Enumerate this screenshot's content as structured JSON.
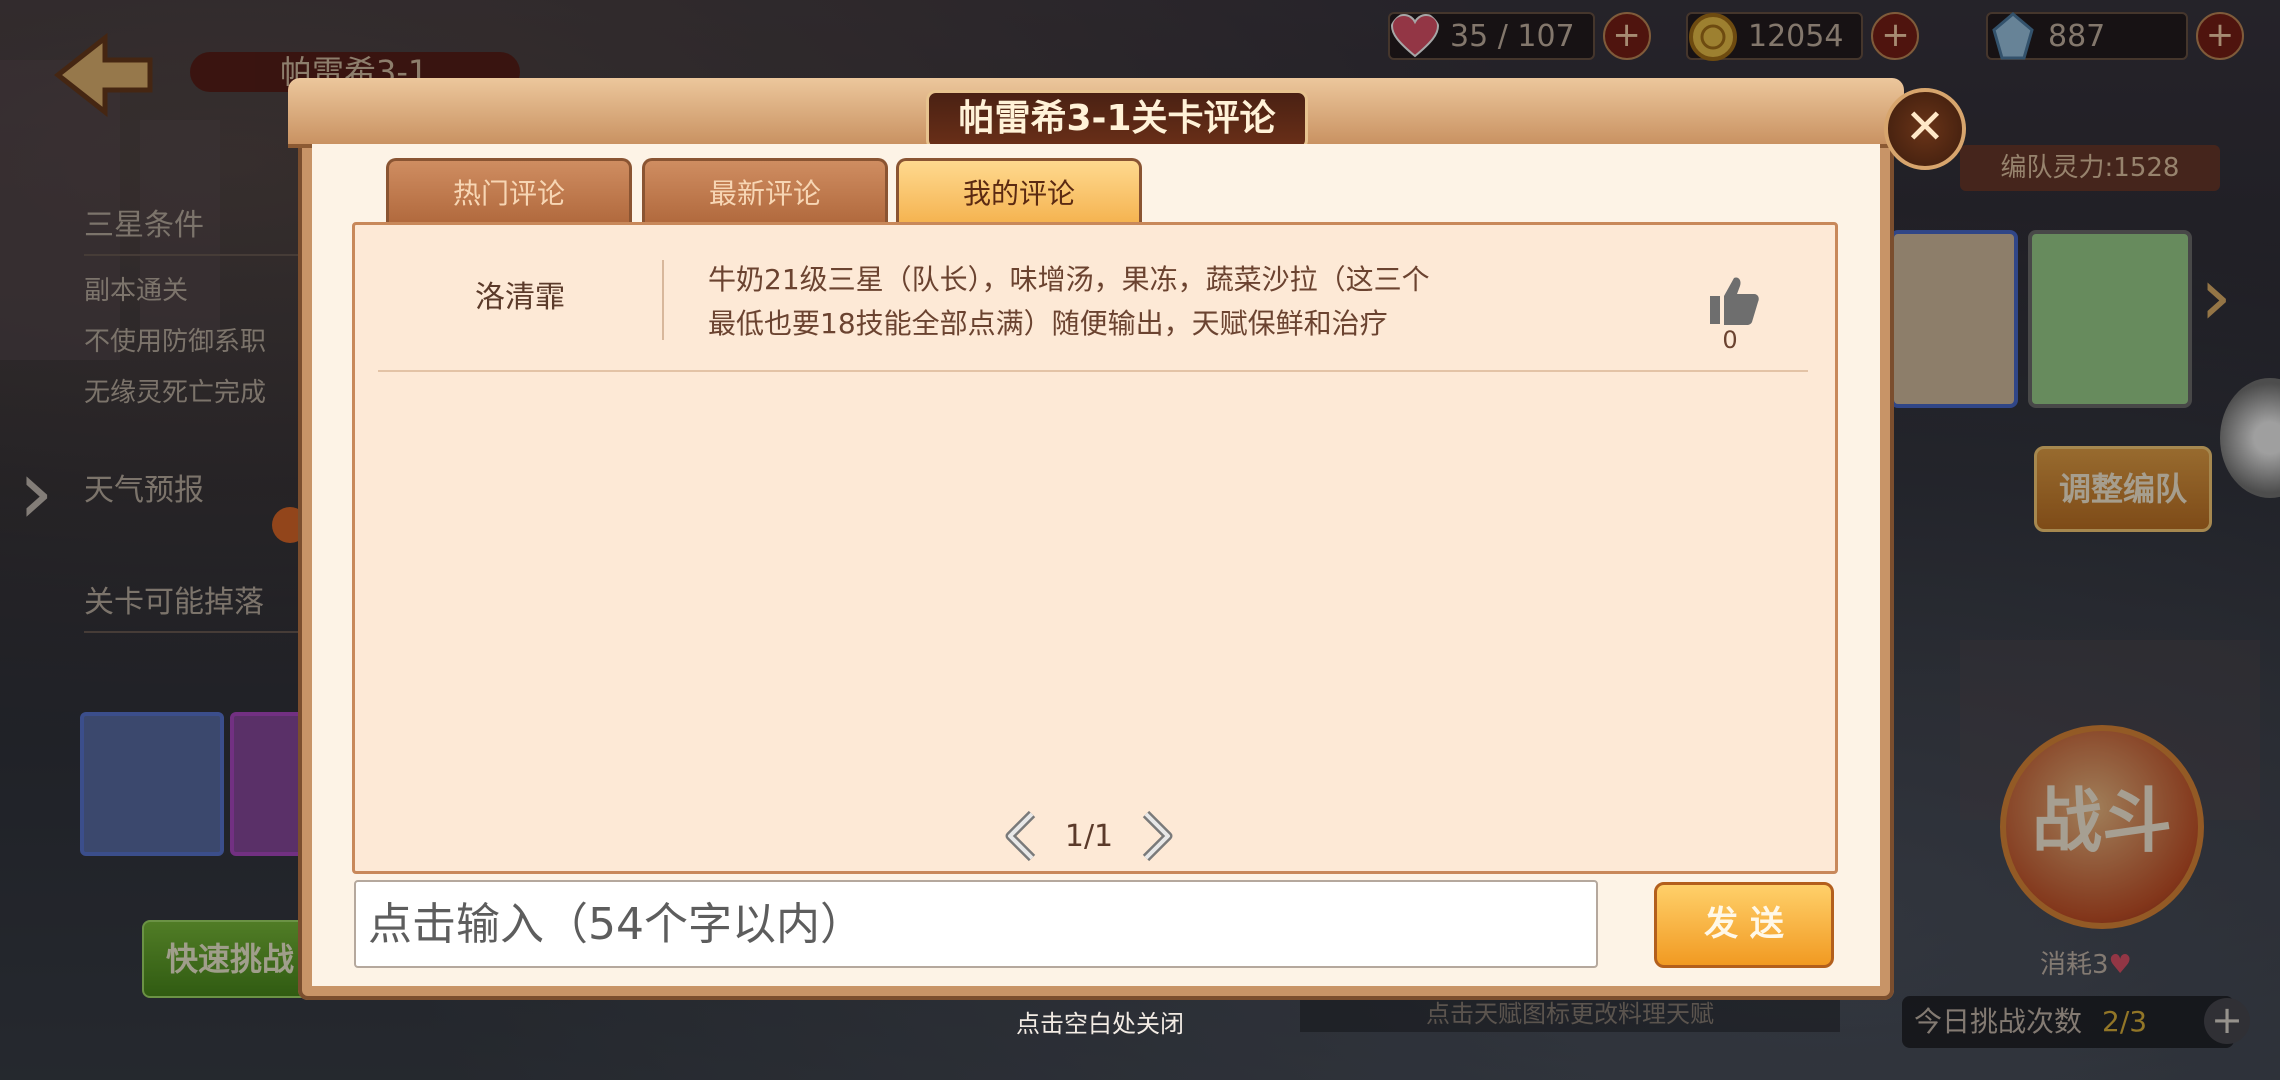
{
  "header": {
    "stage_name": "帕雷希3-1",
    "resources": {
      "stamina": "35 / 107",
      "gold": "12054",
      "gems": "887"
    }
  },
  "left_panel": {
    "three_star_title": "三星条件",
    "conditions": [
      "副本通关",
      "不使用防御系职",
      "无缘灵死亡完成"
    ],
    "weather_title": "天气预报",
    "drops_title": "关卡可能掉落",
    "quick_challenge": "快速挑战"
  },
  "right_panel": {
    "team_power": "编队灵力:1528",
    "adjust_team": "调整编队",
    "fight": "战斗",
    "cost": "消耗3",
    "talent_tip": "点击天赋图标更改料理天赋",
    "attempts_label": "今日挑战次数",
    "attempts_value": "2/3"
  },
  "modal": {
    "title": "帕雷希3-1关卡评论",
    "tabs": [
      {
        "label": "热门评论",
        "active": false
      },
      {
        "label": "最新评论",
        "active": false
      },
      {
        "label": "我的评论",
        "active": true
      }
    ],
    "comments": [
      {
        "user": "洛清霏",
        "text_line1": "牛奶21级三星（队长），味增汤，果冻，蔬菜沙拉（这三个",
        "text_line2": "最低也要18技能全部点满）随便输出，天赋保鲜和治疗",
        "likes": "0"
      }
    ],
    "pagination": "1/1",
    "input_placeholder": "点击输入（54个字以内）",
    "send_label": "发 送",
    "close_hint": "点击空白处关闭"
  },
  "colors": {
    "modal_bg": "#fdf3e6",
    "tab_active": "#f4b24e",
    "tab_inactive": "#b0683c",
    "send_button": "#f19a22",
    "title_plate": "#4a2113"
  },
  "icons": [
    "back-arrow-icon",
    "heart-icon",
    "gold-coin-icon",
    "gem-icon",
    "plus-icon",
    "close-icon",
    "thumbs-up-icon",
    "chevron-left-icon",
    "chevron-right-icon",
    "sun-icon"
  ]
}
